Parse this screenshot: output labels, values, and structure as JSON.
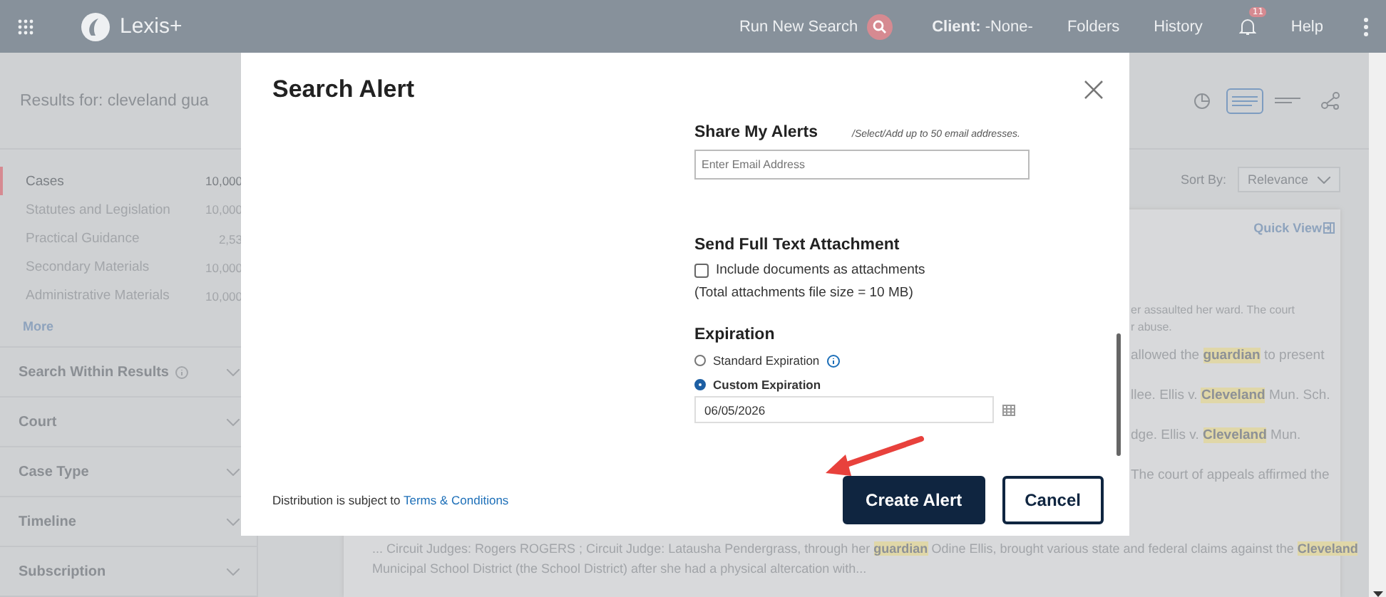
{
  "header": {
    "app_name": "Lexis+",
    "run_search": "Run New Search",
    "client_label": "Client:",
    "client_value": "-None-",
    "links": [
      "Folders",
      "History"
    ],
    "notification_badge": "11",
    "help": "Help"
  },
  "results": {
    "title": "Results for: cleveland gua",
    "views": [
      {
        "kind": "chart",
        "selected": false
      },
      {
        "kind": "list",
        "selected": true
      },
      {
        "kind": "lines",
        "selected": false
      },
      {
        "kind": "graph",
        "selected": false
      }
    ]
  },
  "sidebar": {
    "categories": [
      {
        "label": "Cases",
        "count": "10,000",
        "selected": true
      },
      {
        "label": "Statutes and Legislation",
        "count": "10,000",
        "selected": false
      },
      {
        "label": "Practical Guidance",
        "count": "2,53",
        "selected": false
      },
      {
        "label": "Secondary Materials",
        "count": "10,000",
        "selected": false
      },
      {
        "label": "Administrative Materials",
        "count": "10,000",
        "selected": false
      }
    ],
    "more": "More",
    "filters": [
      {
        "label": "Search Within Results",
        "info": true
      },
      {
        "label": "Court",
        "info": false
      },
      {
        "label": "Case Type",
        "info": false
      },
      {
        "label": "Timeline",
        "info": false
      },
      {
        "label": "Subscription",
        "info": false
      }
    ]
  },
  "sort": {
    "label": "Sort By:",
    "value": "Relevance"
  },
  "card": {
    "quick_view": "Quick View",
    "fragments": [
      {
        "text": "er assaulted her ward. The court",
        "kind": "small"
      },
      {
        "text": "r abuse.",
        "kind": "small"
      },
      {
        "text": "allowed the **guardian** to present",
        "kind": "normal"
      },
      {
        "text": "llee. Ellis v. **Cleveland** Mun. Sch.",
        "kind": "normal"
      },
      {
        "text": "dge. Ellis v. **Cleveland** Mun.",
        "kind": "normal"
      },
      {
        "text": "The court of appeals affirmed the",
        "kind": "normal"
      }
    ],
    "lines": [
      "... Circuit Judges: Rogers ROGERS ; Circuit Judge: Latausha Pendergrass, through her **guardian** Odine Ellis, brought various state and federal claims against the **Cleveland**",
      "Municipal School District (the School District) after she had a physical altercation with..."
    ]
  },
  "modal": {
    "title": "Search Alert",
    "share": {
      "heading": "Share My Alerts",
      "hint": "/Select/Add up to 50 email addresses.",
      "placeholder": "Enter Email Address"
    },
    "attachment": {
      "heading": "Send Full Text Attachment",
      "checkbox_label": "Include documents as attachments",
      "checked": false,
      "note": "(Total attachments file size = 10 MB)"
    },
    "expiration": {
      "heading": "Expiration",
      "options": [
        {
          "label": "Standard Expiration",
          "info": true,
          "selected": false
        },
        {
          "label": "Custom Expiration",
          "info": false,
          "selected": true
        }
      ],
      "date": "06/05/2026"
    },
    "footer_text": "Distribution is subject to",
    "footer_link": "Terms & Conditions",
    "buttons": [
      {
        "label": "Create Alert",
        "kind": "primary"
      },
      {
        "label": "Cancel",
        "kind": "secondary"
      }
    ]
  }
}
